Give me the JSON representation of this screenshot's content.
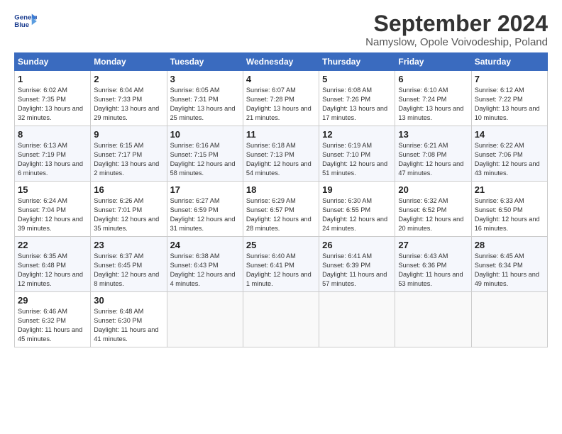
{
  "header": {
    "logo_line1": "General",
    "logo_line2": "Blue",
    "month": "September 2024",
    "location": "Namyslow, Opole Voivodeship, Poland"
  },
  "weekdays": [
    "Sunday",
    "Monday",
    "Tuesday",
    "Wednesday",
    "Thursday",
    "Friday",
    "Saturday"
  ],
  "weeks": [
    [
      {
        "day": "1",
        "info": "Sunrise: 6:02 AM\nSunset: 7:35 PM\nDaylight: 13 hours\nand 32 minutes."
      },
      {
        "day": "2",
        "info": "Sunrise: 6:04 AM\nSunset: 7:33 PM\nDaylight: 13 hours\nand 29 minutes."
      },
      {
        "day": "3",
        "info": "Sunrise: 6:05 AM\nSunset: 7:31 PM\nDaylight: 13 hours\nand 25 minutes."
      },
      {
        "day": "4",
        "info": "Sunrise: 6:07 AM\nSunset: 7:28 PM\nDaylight: 13 hours\nand 21 minutes."
      },
      {
        "day": "5",
        "info": "Sunrise: 6:08 AM\nSunset: 7:26 PM\nDaylight: 13 hours\nand 17 minutes."
      },
      {
        "day": "6",
        "info": "Sunrise: 6:10 AM\nSunset: 7:24 PM\nDaylight: 13 hours\nand 13 minutes."
      },
      {
        "day": "7",
        "info": "Sunrise: 6:12 AM\nSunset: 7:22 PM\nDaylight: 13 hours\nand 10 minutes."
      }
    ],
    [
      {
        "day": "8",
        "info": "Sunrise: 6:13 AM\nSunset: 7:19 PM\nDaylight: 13 hours\nand 6 minutes."
      },
      {
        "day": "9",
        "info": "Sunrise: 6:15 AM\nSunset: 7:17 PM\nDaylight: 13 hours\nand 2 minutes."
      },
      {
        "day": "10",
        "info": "Sunrise: 6:16 AM\nSunset: 7:15 PM\nDaylight: 12 hours\nand 58 minutes."
      },
      {
        "day": "11",
        "info": "Sunrise: 6:18 AM\nSunset: 7:13 PM\nDaylight: 12 hours\nand 54 minutes."
      },
      {
        "day": "12",
        "info": "Sunrise: 6:19 AM\nSunset: 7:10 PM\nDaylight: 12 hours\nand 51 minutes."
      },
      {
        "day": "13",
        "info": "Sunrise: 6:21 AM\nSunset: 7:08 PM\nDaylight: 12 hours\nand 47 minutes."
      },
      {
        "day": "14",
        "info": "Sunrise: 6:22 AM\nSunset: 7:06 PM\nDaylight: 12 hours\nand 43 minutes."
      }
    ],
    [
      {
        "day": "15",
        "info": "Sunrise: 6:24 AM\nSunset: 7:04 PM\nDaylight: 12 hours\nand 39 minutes."
      },
      {
        "day": "16",
        "info": "Sunrise: 6:26 AM\nSunset: 7:01 PM\nDaylight: 12 hours\nand 35 minutes."
      },
      {
        "day": "17",
        "info": "Sunrise: 6:27 AM\nSunset: 6:59 PM\nDaylight: 12 hours\nand 31 minutes."
      },
      {
        "day": "18",
        "info": "Sunrise: 6:29 AM\nSunset: 6:57 PM\nDaylight: 12 hours\nand 28 minutes."
      },
      {
        "day": "19",
        "info": "Sunrise: 6:30 AM\nSunset: 6:55 PM\nDaylight: 12 hours\nand 24 minutes."
      },
      {
        "day": "20",
        "info": "Sunrise: 6:32 AM\nSunset: 6:52 PM\nDaylight: 12 hours\nand 20 minutes."
      },
      {
        "day": "21",
        "info": "Sunrise: 6:33 AM\nSunset: 6:50 PM\nDaylight: 12 hours\nand 16 minutes."
      }
    ],
    [
      {
        "day": "22",
        "info": "Sunrise: 6:35 AM\nSunset: 6:48 PM\nDaylight: 12 hours\nand 12 minutes."
      },
      {
        "day": "23",
        "info": "Sunrise: 6:37 AM\nSunset: 6:45 PM\nDaylight: 12 hours\nand 8 minutes."
      },
      {
        "day": "24",
        "info": "Sunrise: 6:38 AM\nSunset: 6:43 PM\nDaylight: 12 hours\nand 4 minutes."
      },
      {
        "day": "25",
        "info": "Sunrise: 6:40 AM\nSunset: 6:41 PM\nDaylight: 12 hours\nand 1 minute."
      },
      {
        "day": "26",
        "info": "Sunrise: 6:41 AM\nSunset: 6:39 PM\nDaylight: 11 hours\nand 57 minutes."
      },
      {
        "day": "27",
        "info": "Sunrise: 6:43 AM\nSunset: 6:36 PM\nDaylight: 11 hours\nand 53 minutes."
      },
      {
        "day": "28",
        "info": "Sunrise: 6:45 AM\nSunset: 6:34 PM\nDaylight: 11 hours\nand 49 minutes."
      }
    ],
    [
      {
        "day": "29",
        "info": "Sunrise: 6:46 AM\nSunset: 6:32 PM\nDaylight: 11 hours\nand 45 minutes."
      },
      {
        "day": "30",
        "info": "Sunrise: 6:48 AM\nSunset: 6:30 PM\nDaylight: 11 hours\nand 41 minutes."
      },
      {
        "day": "",
        "info": ""
      },
      {
        "day": "",
        "info": ""
      },
      {
        "day": "",
        "info": ""
      },
      {
        "day": "",
        "info": ""
      },
      {
        "day": "",
        "info": ""
      }
    ]
  ]
}
